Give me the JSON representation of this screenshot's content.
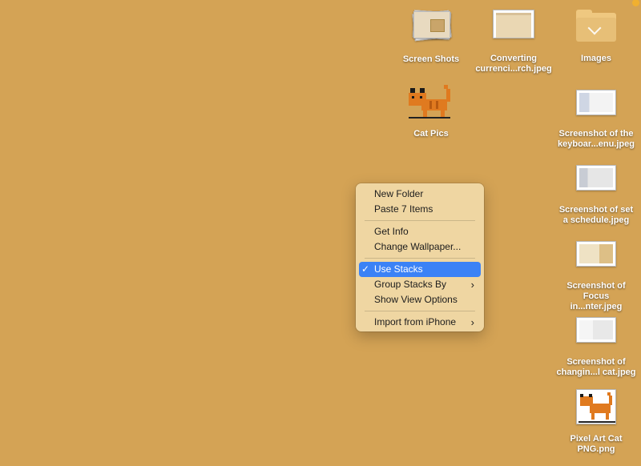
{
  "desktop": {
    "background": "#d4a355",
    "items": [
      {
        "label": "Screen Shots",
        "kind": "stack"
      },
      {
        "label": "Converting currenci...rch.jpeg",
        "kind": "screenshot"
      },
      {
        "label": "Images",
        "kind": "folder"
      },
      {
        "label": "Cat Pics",
        "kind": "pixel-cat"
      },
      {
        "label": "Screenshot of the keyboar...enu.jpeg",
        "kind": "screenshot"
      },
      {
        "label": "Screenshot of set a schedule.jpeg",
        "kind": "screenshot"
      },
      {
        "label": "Screenshot of Focus in...nter.jpeg",
        "kind": "screenshot"
      },
      {
        "label": "Screenshot of changin...l cat.jpeg",
        "kind": "screenshot"
      },
      {
        "label": "Pixel Art Cat PNG.png",
        "kind": "pixel-cat"
      }
    ]
  },
  "context_menu": {
    "groups": [
      [
        {
          "label": "New Folder"
        },
        {
          "label": "Paste 7 Items"
        }
      ],
      [
        {
          "label": "Get Info"
        },
        {
          "label": "Change Wallpaper..."
        }
      ],
      [
        {
          "label": "Use Stacks",
          "checked": true,
          "highlighted": true
        },
        {
          "label": "Group Stacks By",
          "submenu": true
        },
        {
          "label": "Show View Options"
        }
      ],
      [
        {
          "label": "Import from iPhone",
          "submenu": true
        }
      ]
    ],
    "check_glyph": "✓",
    "submenu_glyph": "›",
    "highlight_color": "#3b82f6"
  }
}
